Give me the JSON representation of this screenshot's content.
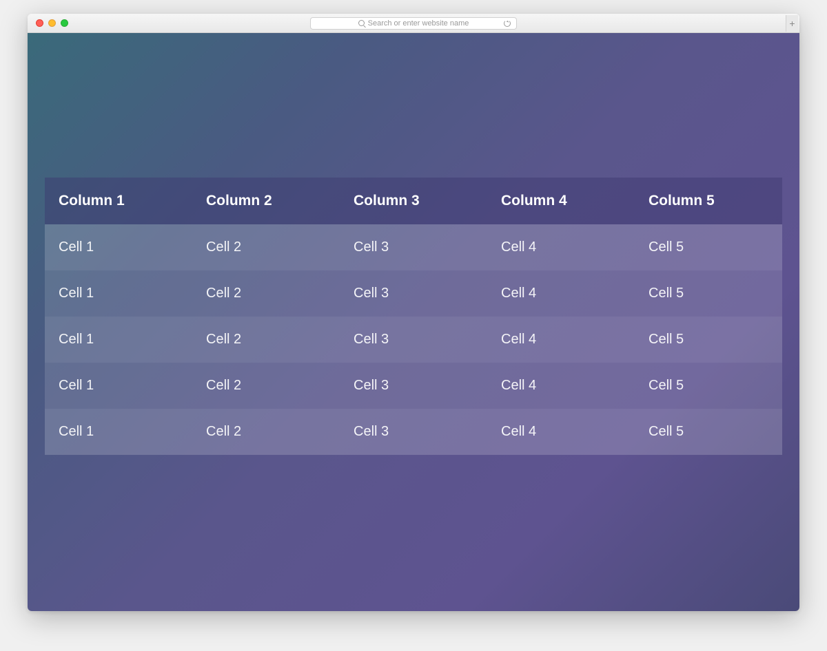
{
  "browser": {
    "address_placeholder": "Search or enter website name"
  },
  "table": {
    "headers": [
      "Column 1",
      "Column 2",
      "Column 3",
      "Column 4",
      "Column 5"
    ],
    "rows": [
      [
        "Cell 1",
        "Cell 2",
        "Cell 3",
        "Cell 4",
        "Cell 5"
      ],
      [
        "Cell 1",
        "Cell 2",
        "Cell 3",
        "Cell 4",
        "Cell 5"
      ],
      [
        "Cell 1",
        "Cell 2",
        "Cell 3",
        "Cell 4",
        "Cell 5"
      ],
      [
        "Cell 1",
        "Cell 2",
        "Cell 3",
        "Cell 4",
        "Cell 5"
      ],
      [
        "Cell 1",
        "Cell 2",
        "Cell 3",
        "Cell 4",
        "Cell 5"
      ]
    ]
  }
}
